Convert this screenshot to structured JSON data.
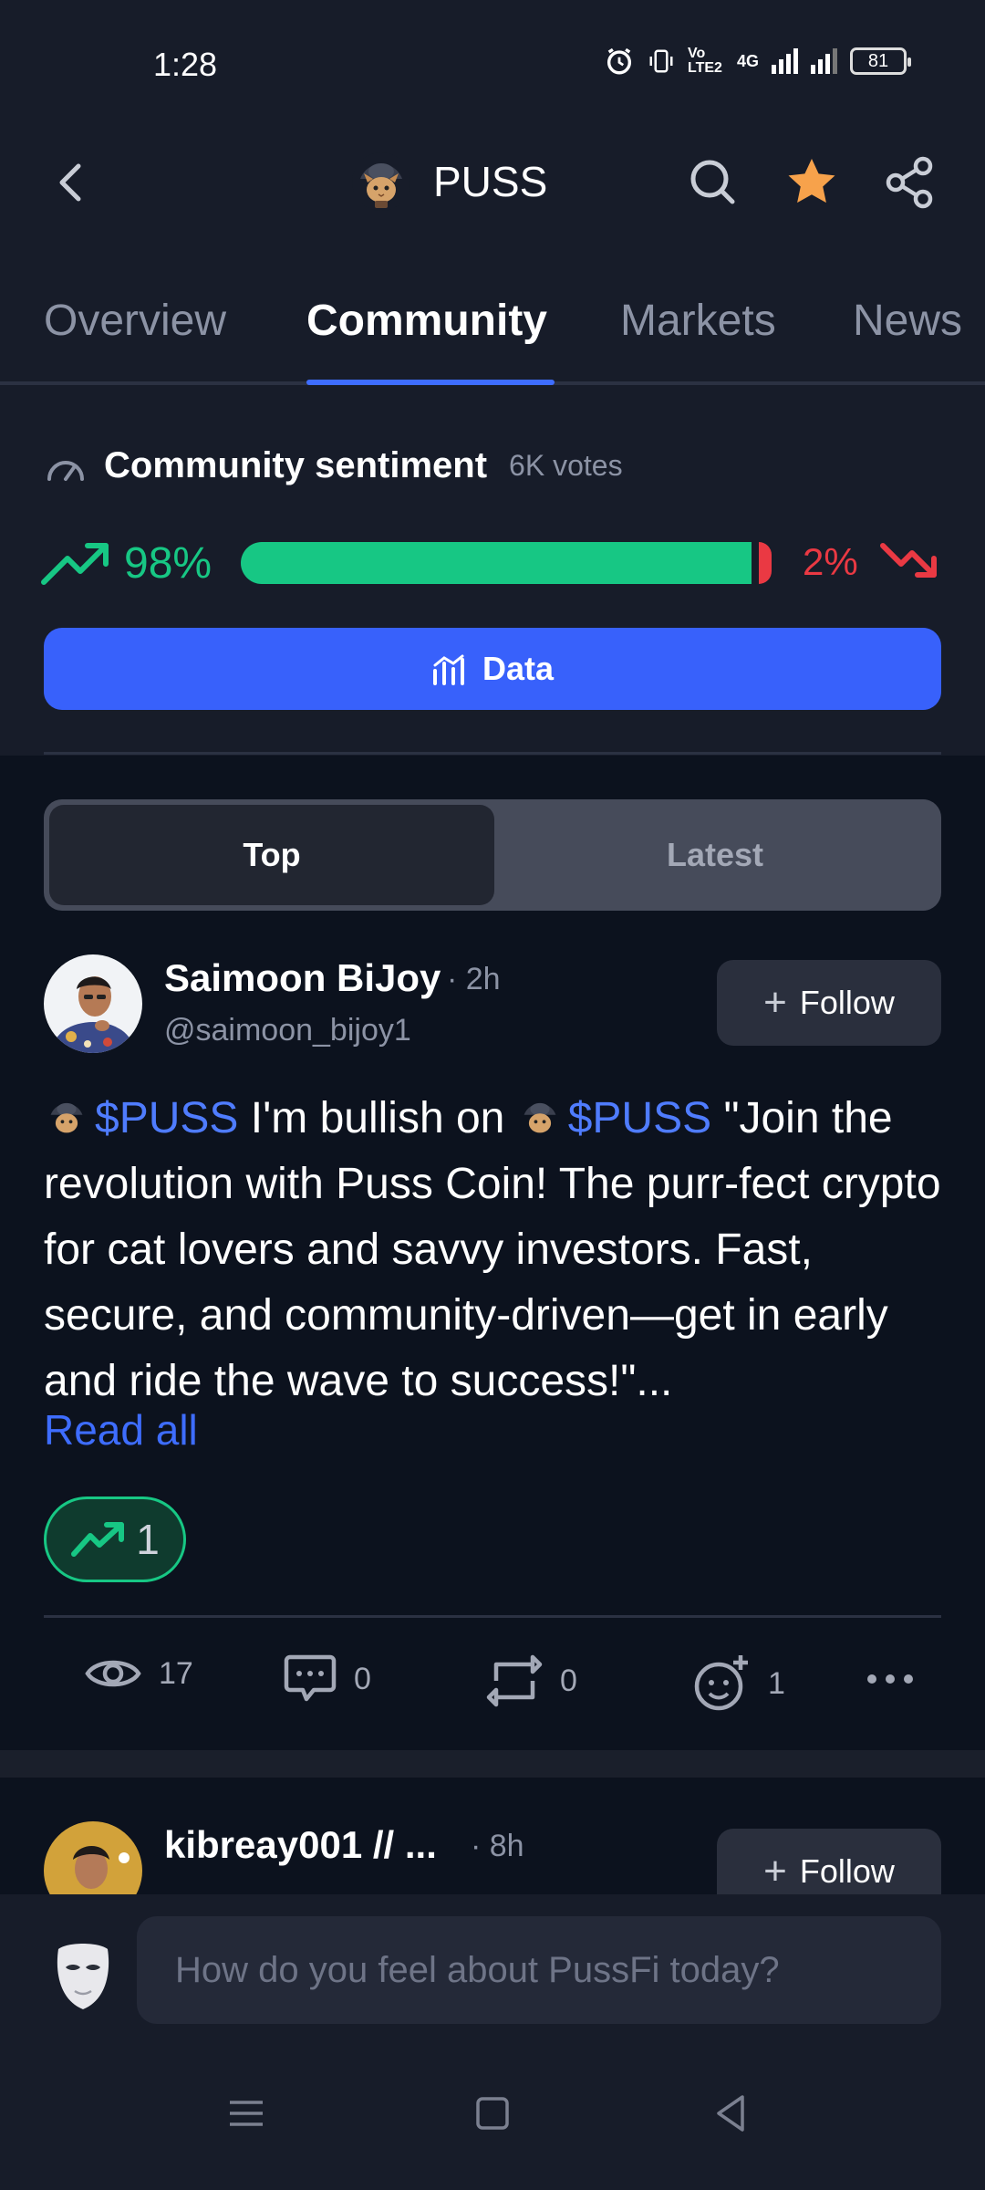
{
  "status_bar": {
    "time": "1:28",
    "network_label": "Vo LTE2",
    "network_type": "4G",
    "battery": "81"
  },
  "header": {
    "title": "PUSS",
    "back_icon": "chevron-left-icon",
    "icons": [
      "search-icon",
      "star-icon",
      "share-icon"
    ],
    "star_color": "#f7a24b"
  },
  "tabs": [
    {
      "label": "Overview",
      "active": false
    },
    {
      "label": "Community",
      "active": true
    },
    {
      "label": "Markets",
      "active": false
    },
    {
      "label": "News",
      "active": false
    }
  ],
  "sentiment": {
    "title": "Community sentiment",
    "votes": "6K votes",
    "bullish_pct": "98%",
    "bearish_pct": "2%",
    "bullish_fraction": 0.98,
    "bull_color": "#17c784",
    "bear_color": "#ea3943"
  },
  "data_button": {
    "label": "Data"
  },
  "feed_toggle": {
    "top": "Top",
    "latest": "Latest",
    "selected": "Top"
  },
  "posts": [
    {
      "name": "Saimoon BiJoy",
      "time": "· 2h",
      "handle": "@saimoon_bijoy1",
      "follow_label": "Follow",
      "cashtag1": "$PUSS",
      "text_mid": " I'm bullish on ",
      "cashtag2": "$PUSS",
      "text_rest": " \"Join the revolution with Puss Coin! The purr-fect crypto for cat lovers and savvy investors. Fast, secure, and community-driven—get in early and ride the wave to success!\"...",
      "read_all": "Read all",
      "bullish_count": "1",
      "views": "17",
      "comments": "0",
      "reposts": "0",
      "reactions": "1"
    },
    {
      "name": "kibreay001 // ...",
      "time": "· 8h",
      "follow_label": "Follow"
    }
  ],
  "composer": {
    "placeholder": "How do you feel about PussFi today?"
  },
  "nav_bar": {
    "icons": [
      "menu-icon",
      "home-square-icon",
      "back-triangle-icon"
    ]
  }
}
